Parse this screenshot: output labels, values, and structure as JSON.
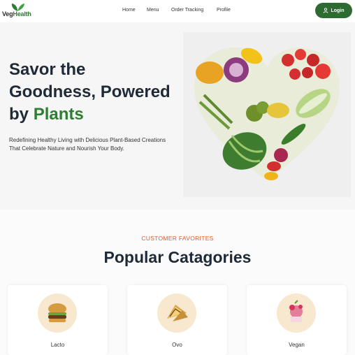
{
  "brand": {
    "name_part1": "Veg",
    "name_part2": "Health"
  },
  "nav": {
    "items": [
      "Home",
      "Menu",
      "Order Tracking",
      "Profile"
    ],
    "login_label": "Login"
  },
  "hero": {
    "title_line1": "Savor the",
    "title_line2": "Goodness, Powered",
    "title_line3_prefix": "by",
    "title_line3_highlight": "Plants",
    "description": "Redefining Healthy Living with Delicious Plant-Based Creations That Celebrate Nature and Nourish Your Body."
  },
  "section": {
    "eyebrow": "CUSTOMER FAVORITES",
    "title": "Popular Catagories"
  },
  "categories": [
    {
      "label": "Lacto",
      "icon": "burger-icon"
    },
    {
      "label": "Ovo",
      "icon": "sandwich-icon"
    },
    {
      "label": "Vegan",
      "icon": "dessert-icon"
    }
  ],
  "colors": {
    "brand_green": "#2e6b32",
    "accent_orange": "#e05a2b"
  }
}
